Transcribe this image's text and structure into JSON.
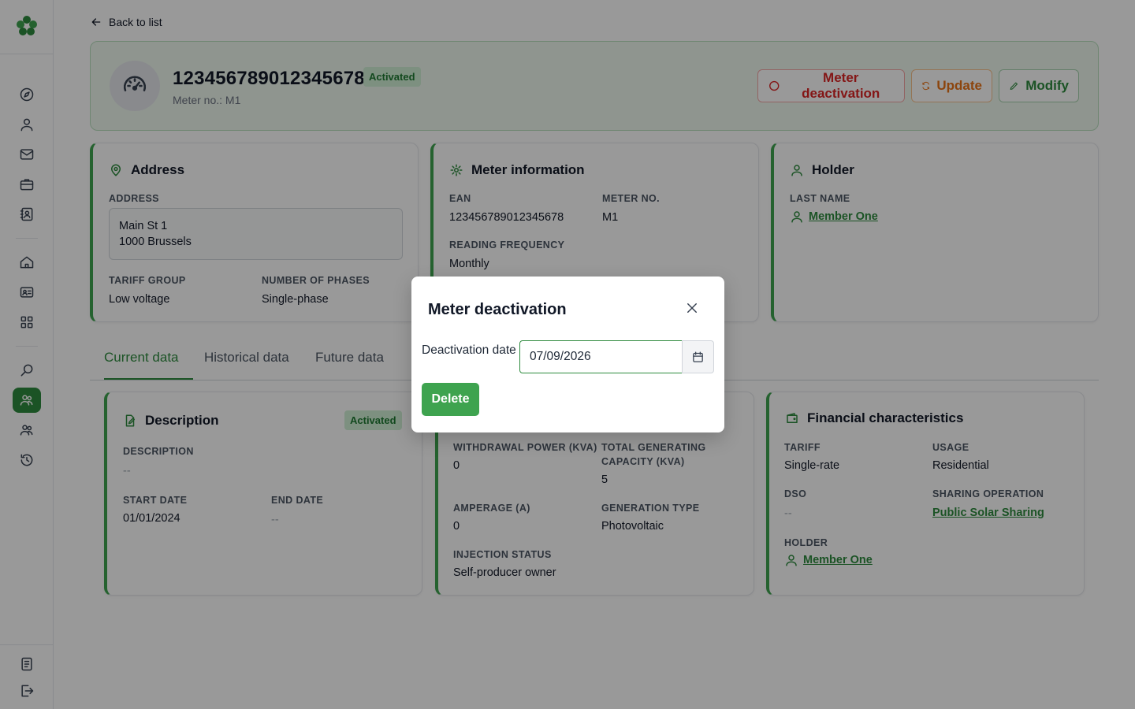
{
  "nav": {
    "back_label": "Back to list"
  },
  "meter": {
    "ean": "123456789012345678",
    "status": "Activated",
    "meter_no_text": "Meter no.: M1",
    "actions": {
      "deactivate": "Meter deactivation",
      "update": "Update",
      "modify": "Modify"
    }
  },
  "address_card": {
    "title": "Address",
    "address_label": "ADDRESS",
    "address_line1": "Main St 1",
    "address_line2": "1000 Brussels",
    "tariff_group_label": "TARIFF GROUP",
    "tariff_group": "Low voltage",
    "phases_label": "NUMBER OF PHASES",
    "phases": "Single-phase"
  },
  "meter_info_card": {
    "title": "Meter information",
    "ean_label": "EAN",
    "ean": "123456789012345678",
    "meter_no_label": "METER NO.",
    "meter_no": "M1",
    "reading_frequency_label": "READING FREQUENCY",
    "reading_frequency": "Monthly"
  },
  "holder_card": {
    "title": "Holder",
    "last_name_label": "LAST NAME",
    "last_name": "Member One"
  },
  "tabs": [
    "Current data",
    "Historical data",
    "Future data"
  ],
  "description_card": {
    "title": "Description",
    "status": "Activated",
    "description_label": "DESCRIPTION",
    "description": "--",
    "start_date_label": "START DATE",
    "start_date": "01/01/2024",
    "end_date_label": "END DATE",
    "end_date": "--"
  },
  "technical_card": {
    "withdrawal_power_label": "WITHDRAWAL POWER (KVA)",
    "withdrawal_power": "0",
    "generating_capacity_label_1": "TOTAL GENERATING",
    "generating_capacity_label_2": "CAPACITY (KVA)",
    "generating_capacity": "5",
    "amperage_label": "AMPERAGE (A)",
    "amperage": "0",
    "generation_type_label": "GENERATION TYPE",
    "generation_type": "Photovoltaic",
    "injection_status_label": "INJECTION STATUS",
    "injection_status": "Self-producer owner"
  },
  "financial_card": {
    "title": "Financial characteristics",
    "tariff_label": "TARIFF",
    "tariff": "Single-rate",
    "usage_label": "USAGE",
    "usage": "Residential",
    "dso_label": "DSO",
    "dso": "--",
    "sharing_operation_label": "SHARING OPERATION",
    "sharing_operation": "Public Solar Sharing",
    "holder_label": "HOLDER",
    "holder": "Member One"
  },
  "modal": {
    "title": "Meter deactivation",
    "date_label": "Deactivation date",
    "date_value": "07/09/2026",
    "delete_label": "Delete"
  },
  "colors": {
    "brand_green": "#2e8b3e",
    "danger": "#dc2626",
    "warning": "#ea7317"
  }
}
